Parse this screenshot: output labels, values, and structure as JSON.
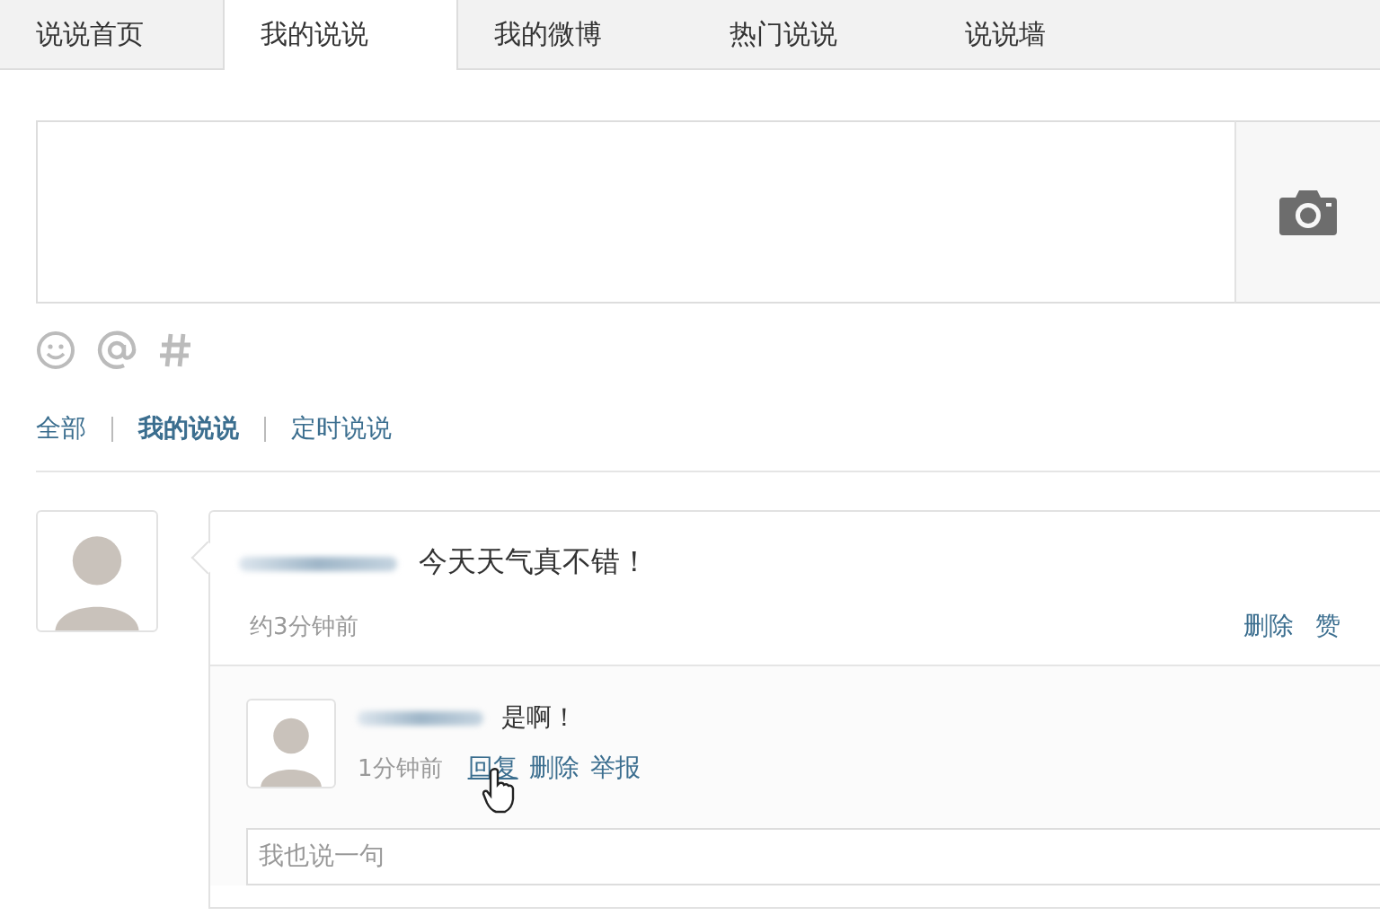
{
  "tabs": [
    {
      "label": "说说首页",
      "selected": false
    },
    {
      "label": "我的说说",
      "selected": true
    },
    {
      "label": "我的微博",
      "selected": false
    },
    {
      "label": "热门说说",
      "selected": false
    },
    {
      "label": "说说墙",
      "selected": false
    }
  ],
  "filters": [
    {
      "label": "全部",
      "selected": false
    },
    {
      "label": "我的说说",
      "selected": true
    },
    {
      "label": "定时说说",
      "selected": false
    }
  ],
  "post": {
    "text": "今天天气真不错！",
    "time": "约3分钟前",
    "actions": [
      "删除",
      "赞"
    ],
    "reply": {
      "text": "是啊！",
      "time": "1分钟前",
      "actions": [
        {
          "label": "回复",
          "hovered": true
        },
        {
          "label": "删除",
          "hovered": false
        },
        {
          "label": "举报",
          "hovered": false
        }
      ]
    },
    "comment_box": {
      "placeholder": "我也说一句"
    }
  }
}
